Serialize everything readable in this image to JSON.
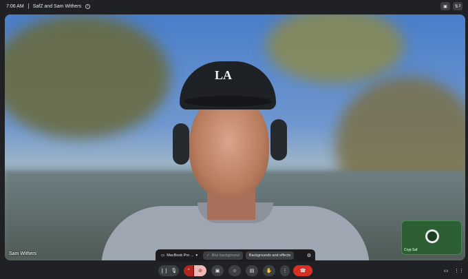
{
  "topbar": {
    "time": "7:06 AM",
    "meeting_title": "SafZ and Sam Withers",
    "info_icon": "info-icon",
    "right_icons": [
      "camera-off-icon",
      "people-icon"
    ],
    "participants_count": "2"
  },
  "main_video": {
    "participant_name": "Sam Withers",
    "cap_logo": "LA"
  },
  "self_view": {
    "name": "Cryp Saf"
  },
  "effects": {
    "camera_device": "MacBook Pro ...",
    "blur_label": "Blur background",
    "backgrounds_label": "Backgrounds and effects"
  },
  "controls": {
    "buttons": [
      "audio-levels-icon",
      "mic-icon",
      "chevron-up-icon",
      "camera-off-icon",
      "present-icon",
      "emoji-icon",
      "captions-icon",
      "raise-hand-icon",
      "more-icon",
      "end-call-icon"
    ],
    "right": [
      "chat-icon",
      "apps-icon"
    ]
  },
  "colors": {
    "background": "#202124",
    "end_call": "#d93025",
    "camera_off_active": "#f2b8b5"
  }
}
